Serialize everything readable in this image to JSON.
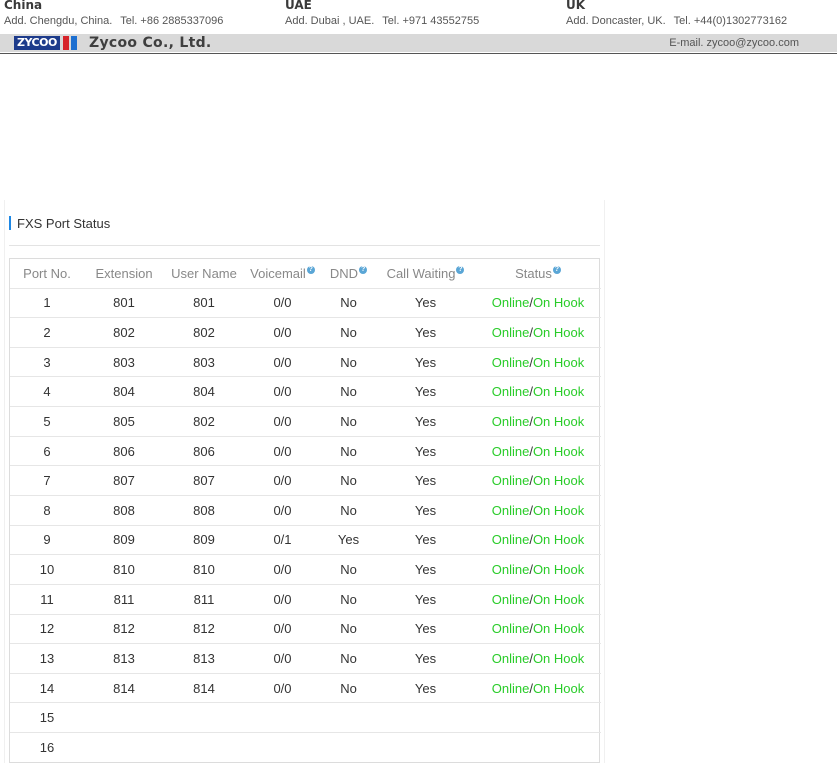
{
  "letterhead": {
    "offices": [
      {
        "country": "China",
        "address": "Add. Chengdu, China.",
        "tel": "Tel. +86 2885337096"
      },
      {
        "country": "UAE",
        "address": "Add. Dubai , UAE.",
        "tel": "Tel. +971 43552755"
      },
      {
        "country": "UK",
        "address": "Add. Doncaster, UK.",
        "tel": "Tel. +44(0)1302773162"
      }
    ],
    "logo_text": "ZYCOO",
    "company": "Zycoo  Co., Ltd.",
    "email": "E-mail. zycoo@zycoo.com",
    "colors": {
      "bar": "#d9d9d9",
      "logo_blue": "#1d3b8b",
      "logo_red": "#d6242b"
    }
  },
  "panel": {
    "title": "FXS Port Status",
    "accent_color": "#1e88e5",
    "columns": [
      "Port No.",
      "Extension",
      "User Name",
      "Voicemail",
      "DND",
      "Call Waiting",
      "Status"
    ],
    "help_icon_columns": [
      "Voicemail",
      "DND",
      "Call Waiting",
      "Status"
    ],
    "rows": [
      {
        "port": "1",
        "extension": "801",
        "user": "801",
        "voicemail": "0/0",
        "dnd": "No",
        "call_waiting": "Yes",
        "status_a": "Online",
        "sep": "/",
        "status_b": "On Hook"
      },
      {
        "port": "2",
        "extension": "802",
        "user": "802",
        "voicemail": "0/0",
        "dnd": "No",
        "call_waiting": "Yes",
        "status_a": "Online",
        "sep": "/",
        "status_b": "On Hook"
      },
      {
        "port": "3",
        "extension": "803",
        "user": "803",
        "voicemail": "0/0",
        "dnd": "No",
        "call_waiting": "Yes",
        "status_a": "Online",
        "sep": "/",
        "status_b": "On Hook"
      },
      {
        "port": "4",
        "extension": "804",
        "user": "804",
        "voicemail": "0/0",
        "dnd": "No",
        "call_waiting": "Yes",
        "status_a": "Online",
        "sep": "/",
        "status_b": "On Hook"
      },
      {
        "port": "5",
        "extension": "805",
        "user": "802",
        "voicemail": "0/0",
        "dnd": "No",
        "call_waiting": "Yes",
        "status_a": "Online",
        "sep": "/",
        "status_b": "On Hook"
      },
      {
        "port": "6",
        "extension": "806",
        "user": "806",
        "voicemail": "0/0",
        "dnd": "No",
        "call_waiting": "Yes",
        "status_a": "Online",
        "sep": "/",
        "status_b": "On Hook"
      },
      {
        "port": "7",
        "extension": "807",
        "user": "807",
        "voicemail": "0/0",
        "dnd": "No",
        "call_waiting": "Yes",
        "status_a": "Online",
        "sep": "/",
        "status_b": "On Hook"
      },
      {
        "port": "8",
        "extension": "808",
        "user": "808",
        "voicemail": "0/0",
        "dnd": "No",
        "call_waiting": "Yes",
        "status_a": "Online",
        "sep": "/",
        "status_b": "On Hook"
      },
      {
        "port": "9",
        "extension": "809",
        "user": "809",
        "voicemail": "0/1",
        "dnd": "Yes",
        "call_waiting": "Yes",
        "status_a": "Online",
        "sep": "/",
        "status_b": "On Hook"
      },
      {
        "port": "10",
        "extension": "810",
        "user": "810",
        "voicemail": "0/0",
        "dnd": "No",
        "call_waiting": "Yes",
        "status_a": "Online",
        "sep": "/",
        "status_b": "On Hook"
      },
      {
        "port": "11",
        "extension": "811",
        "user": "811",
        "voicemail": "0/0",
        "dnd": "No",
        "call_waiting": "Yes",
        "status_a": "Online",
        "sep": "/",
        "status_b": "On Hook"
      },
      {
        "port": "12",
        "extension": "812",
        "user": "812",
        "voicemail": "0/0",
        "dnd": "No",
        "call_waiting": "Yes",
        "status_a": "Online",
        "sep": "/",
        "status_b": "On Hook"
      },
      {
        "port": "13",
        "extension": "813",
        "user": "813",
        "voicemail": "0/0",
        "dnd": "No",
        "call_waiting": "Yes",
        "status_a": "Online",
        "sep": "/",
        "status_b": "On Hook"
      },
      {
        "port": "14",
        "extension": "814",
        "user": "814",
        "voicemail": "0/0",
        "dnd": "No",
        "call_waiting": "Yes",
        "status_a": "Online",
        "sep": "/",
        "status_b": "On Hook"
      },
      {
        "port": "15",
        "extension": "",
        "user": "",
        "voicemail": "",
        "dnd": "",
        "call_waiting": "",
        "status_a": "",
        "sep": "",
        "status_b": ""
      },
      {
        "port": "16",
        "extension": "",
        "user": "",
        "voicemail": "",
        "dnd": "",
        "call_waiting": "",
        "status_a": "",
        "sep": "",
        "status_b": ""
      }
    ],
    "status_color": "#29cc29",
    "help_icon_color": "#5aa6d6"
  }
}
